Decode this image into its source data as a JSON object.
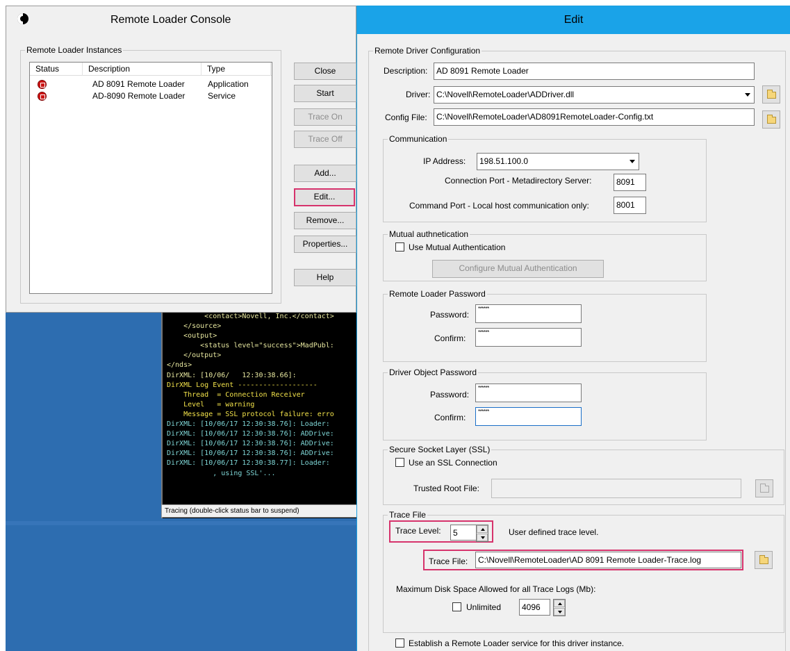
{
  "console": {
    "title": "Remote Loader Console",
    "instances_group": "Remote Loader Instances",
    "columns": [
      "Status",
      "Description",
      "Type"
    ],
    "rows": [
      {
        "description": "AD 8091 Remote Loader",
        "type": "Application",
        "status_icon": "stopped-icon"
      },
      {
        "description": "AD-8090 Remote Loader",
        "type": "Service",
        "status_icon": "stopped-icon"
      }
    ],
    "buttons": {
      "close": "Close",
      "start": "Start",
      "trace_on": "Trace On",
      "trace_off": "Trace Off",
      "add": "Add...",
      "edit": "Edit...",
      "remove": "Remove...",
      "properties": "Properties...",
      "help": "Help"
    }
  },
  "terminal": {
    "lines": [
      {
        "text": "         <contact>Novell, Inc.</contact>",
        "color": "#e8e8a0"
      },
      {
        "text": "    </source>",
        "color": "#e8e8a0"
      },
      {
        "text": "    <output>",
        "color": "#e8e8a0"
      },
      {
        "text": "        <status level=\"success\">MadPubl:",
        "color": "#e8e8a0"
      },
      {
        "text": "    </output>",
        "color": "#e8e8a0"
      },
      {
        "text": "</nds>",
        "color": "#e8e8a0"
      },
      {
        "text": "DirXML: [10/06/   12:30:38.66]:",
        "color": "#e8e8a0"
      },
      {
        "text": "DirXML Log Event -------------------",
        "color": "#f2e24a"
      },
      {
        "text": "    Thread  = Connection Receiver",
        "color": "#f2e24a"
      },
      {
        "text": "    Level   = warning",
        "color": "#f2e24a"
      },
      {
        "text": "    Message = SSL protocol failure: erro",
        "color": "#f2e24a"
      },
      {
        "text": "DirXML: [10/06/17 12:30:38.76]: Loader:",
        "color": "#7fd7d7"
      },
      {
        "text": "DirXML: [10/06/17 12:30:38.76]: ADDrive:",
        "color": "#7fd7d7"
      },
      {
        "text": "DirXML: [10/06/17 12:30:38.76]: ADDrive:",
        "color": "#7fd7d7"
      },
      {
        "text": "DirXML: [10/06/17 12:30:38.76]: ADDrive:",
        "color": "#7fd7d7"
      },
      {
        "text": "DirXML: [10/06/17 12:30:38.77]: Loader:",
        "color": "#7fd7d7"
      },
      {
        "text": "           , using SSL'...",
        "color": "#7fd7d7"
      }
    ],
    "status_bar": "Tracing (double-click status bar to suspend)"
  },
  "edit": {
    "title": "Edit",
    "config_group": "Remote Driver Configuration",
    "description_label": "Description:",
    "description_value": "AD 8091 Remote Loader",
    "driver_label": "Driver:",
    "driver_value": "C:\\Novell\\RemoteLoader\\ADDriver.dll",
    "config_file_label": "Config File:",
    "config_file_value": "C:\\Novell\\RemoteLoader\\AD8091RemoteLoader-Config.txt",
    "communication": {
      "group": "Communication",
      "ip_label": "IP Address:",
      "ip_value": "198.51.100.0",
      "conn_port_label": "Connection Port - Metadirectory Server:",
      "conn_port_value": "8091",
      "cmd_port_label": "Command Port - Local host communication only:",
      "cmd_port_value": "8001"
    },
    "mutual": {
      "group": "Mutual authnetication",
      "checkbox_label": "Use Mutual Authentication",
      "configure_button": "Configure Mutual Authentication"
    },
    "rl_password": {
      "group": "Remote Loader Password",
      "password_label": "Password:",
      "password_value": "******",
      "confirm_label": "Confirm:",
      "confirm_value": "******"
    },
    "driver_password": {
      "group": "Driver Object Password",
      "password_label": "Password:",
      "password_value": "******",
      "confirm_label": "Confirm:",
      "confirm_value": "******"
    },
    "ssl": {
      "group": "Secure Socket Layer (SSL)",
      "checkbox_label": "Use an SSL Connection",
      "trusted_root_label": "Trusted Root File:",
      "trusted_root_value": ""
    },
    "trace": {
      "group": "Trace File",
      "level_label": "Trace Level:",
      "level_value": "5",
      "level_hint": "User defined trace level.",
      "file_label": "Trace File:",
      "file_value": "C:\\Novell\\RemoteLoader\\AD 8091 Remote Loader-Trace.log",
      "max_disk_label": "Maximum Disk Space Allowed for all Trace Logs (Mb):",
      "unlimited_label": "Unlimited",
      "max_disk_value": "4096"
    },
    "service_checkbox_label": "Establish a Remote Loader service for this driver instance."
  },
  "colors": {
    "edit_titlebar": "#1aa3e8",
    "highlight_box": "#d6336c",
    "desktop": "#2d6db0"
  }
}
